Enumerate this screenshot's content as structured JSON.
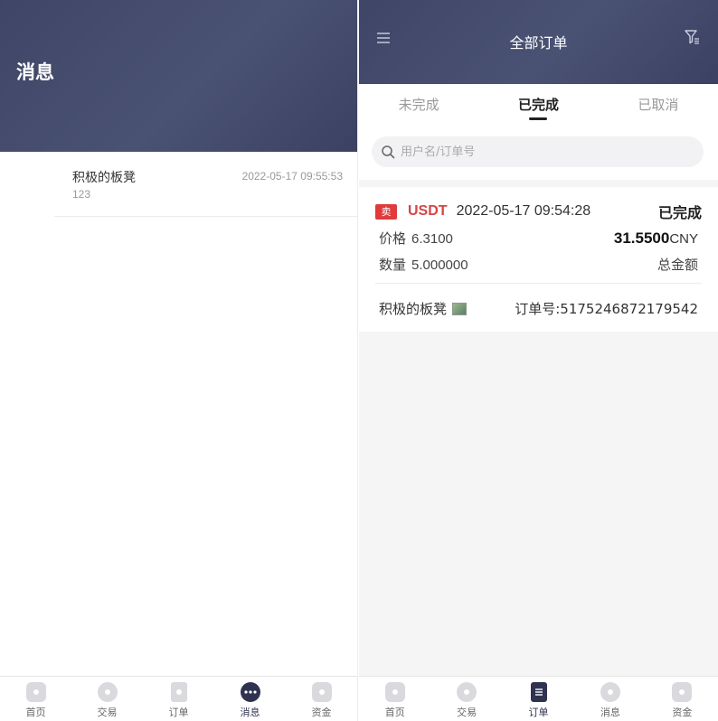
{
  "left": {
    "header": {
      "title": "消息"
    },
    "messages": [
      {
        "name": "积极的板凳",
        "preview": "123",
        "time": "2022-05-17 09:55:53"
      }
    ],
    "tabbar": [
      {
        "label": "首页",
        "icon": "home-icon"
      },
      {
        "label": "交易",
        "icon": "trade-icon"
      },
      {
        "label": "订单",
        "icon": "order-icon"
      },
      {
        "label": "消息",
        "icon": "message-icon",
        "active": true
      },
      {
        "label": "资金",
        "icon": "wallet-icon"
      }
    ]
  },
  "right": {
    "header": {
      "title": "全部订单",
      "menu_icon": "menu-icon",
      "filter_icon": "filter-icon"
    },
    "tabs": [
      {
        "label": "未完成"
      },
      {
        "label": "已完成",
        "active": true
      },
      {
        "label": "已取消"
      }
    ],
    "search": {
      "placeholder": "用户名/订单号",
      "value": ""
    },
    "orders": [
      {
        "side": "卖",
        "coin": "USDT",
        "time": "2022-05-17 09:54:28",
        "status": "已完成",
        "price_label": "价格",
        "price": "6.3100",
        "qty_label": "数量",
        "qty": "5.000000",
        "amount": "31.5500",
        "currency": "CNY",
        "amount_label": "总金额",
        "user": "积极的板凳",
        "order_no_label": "订单号:",
        "order_no": "5175246872179542"
      }
    ],
    "tabbar": [
      {
        "label": "首页",
        "icon": "home-icon"
      },
      {
        "label": "交易",
        "icon": "trade-icon"
      },
      {
        "label": "订单",
        "icon": "order-icon",
        "active": true
      },
      {
        "label": "消息",
        "icon": "message-icon"
      },
      {
        "label": "资金",
        "icon": "wallet-icon"
      }
    ]
  },
  "colors": {
    "header": "#434a6c",
    "accent": "#2f3350",
    "sell_badge": "#e03a3a",
    "coin": "#d64545"
  }
}
